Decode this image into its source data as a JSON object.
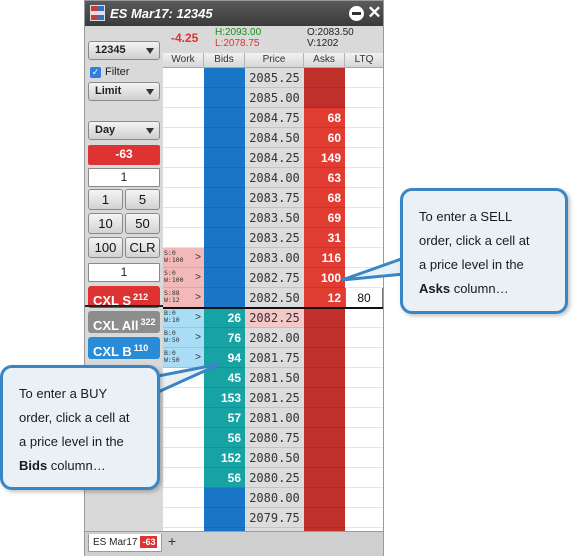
{
  "window": {
    "title": "ES Mar17: 12345",
    "minimize_icon": "minus-circle-icon",
    "close_icon": "close-x-icon"
  },
  "controls": {
    "account": "12345",
    "filter_label": "Filter",
    "filter_checked": true,
    "order_type": "Limit",
    "tif": "Day",
    "position": "-63",
    "quantity": "1",
    "qty_buttons": [
      "1",
      "5",
      "10",
      "50",
      "100",
      "CLR"
    ],
    "quantity2": "1",
    "cxl_s_label": "CXL S",
    "cxl_s_count": "212",
    "cxl_all_label": "CXL All",
    "cxl_all_count": "322",
    "cxl_b_label": "CXL B",
    "cxl_b_count": "110"
  },
  "stats": {
    "net_change": "-4.25",
    "high": "H:2093.00",
    "low": "L:2078.75",
    "open": "O:2083.50",
    "volume": "V:1202"
  },
  "ladder": {
    "headers": [
      "Work",
      "Bids",
      "Price",
      "Asks",
      "LTQ"
    ],
    "rows": [
      {
        "price": "2085.25",
        "bid": "",
        "ask": "",
        "work": "",
        "ltq": ""
      },
      {
        "price": "2085.00",
        "bid": "",
        "ask": "",
        "work": "",
        "ltq": ""
      },
      {
        "price": "2084.75",
        "bid": "",
        "ask": "68",
        "work": "",
        "ltq": ""
      },
      {
        "price": "2084.50",
        "bid": "",
        "ask": "60",
        "work": "",
        "ltq": ""
      },
      {
        "price": "2084.25",
        "bid": "",
        "ask": "149",
        "work": "",
        "ltq": ""
      },
      {
        "price": "2084.00",
        "bid": "",
        "ask": "63",
        "work": "",
        "ltq": ""
      },
      {
        "price": "2083.75",
        "bid": "",
        "ask": "68",
        "work": "",
        "ltq": ""
      },
      {
        "price": "2083.50",
        "bid": "",
        "ask": "69",
        "work": "",
        "ltq": ""
      },
      {
        "price": "2083.25",
        "bid": "",
        "ask": "31",
        "work": "",
        "ltq": ""
      },
      {
        "price": "2083.00",
        "bid": "",
        "ask": "116",
        "work": "S:0\nW:100",
        "ltq": ""
      },
      {
        "price": "2082.75",
        "bid": "",
        "ask": "100",
        "work": "S:0\nW:100",
        "ltq": ""
      },
      {
        "price": "2082.50",
        "bid": "",
        "ask": "12",
        "work": "S:88\nW:12",
        "ltq": "80"
      },
      {
        "price": "2082.25",
        "bid": "26",
        "ask": "",
        "work": "B:0\nW:10",
        "ltq": ""
      },
      {
        "price": "2082.00",
        "bid": "76",
        "ask": "",
        "work": "B:0\nW:50",
        "ltq": ""
      },
      {
        "price": "2081.75",
        "bid": "94",
        "ask": "",
        "work": "B:0\nW:50",
        "ltq": ""
      },
      {
        "price": "2081.50",
        "bid": "45",
        "ask": "",
        "work": "",
        "ltq": ""
      },
      {
        "price": "2081.25",
        "bid": "153",
        "ask": "",
        "work": "",
        "ltq": ""
      },
      {
        "price": "2081.00",
        "bid": "57",
        "ask": "",
        "work": "",
        "ltq": ""
      },
      {
        "price": "2080.75",
        "bid": "56",
        "ask": "",
        "work": "",
        "ltq": ""
      },
      {
        "price": "2080.50",
        "bid": "152",
        "ask": "",
        "work": "",
        "ltq": ""
      },
      {
        "price": "2080.25",
        "bid": "56",
        "ask": "",
        "work": "",
        "ltq": ""
      },
      {
        "price": "2080.00",
        "bid": "",
        "ask": "",
        "work": "",
        "ltq": ""
      },
      {
        "price": "2079.75",
        "bid": "",
        "ask": "",
        "work": "",
        "ltq": ""
      }
    ]
  },
  "tabbar": {
    "tab_label": "ES Mar17",
    "tab_badge": "-63",
    "add_label": "+"
  },
  "callouts": {
    "sell": {
      "line1": "To enter a SELL",
      "line2": "order, click a cell at",
      "line3": "a price level in the",
      "bold": "Asks",
      "tail": " column…"
    },
    "buy": {
      "line1": "To enter a BUY",
      "line2": "order, click a cell at",
      "line3": "a price level in the",
      "bold": "Bids",
      "tail": " column…"
    }
  },
  "colors": {
    "bid_column": "#1976c6",
    "bid_size": "#17a3a3",
    "ask_column": "#c0302b",
    "ask_size": "#e03c32",
    "callout_border": "#3a86c4"
  }
}
